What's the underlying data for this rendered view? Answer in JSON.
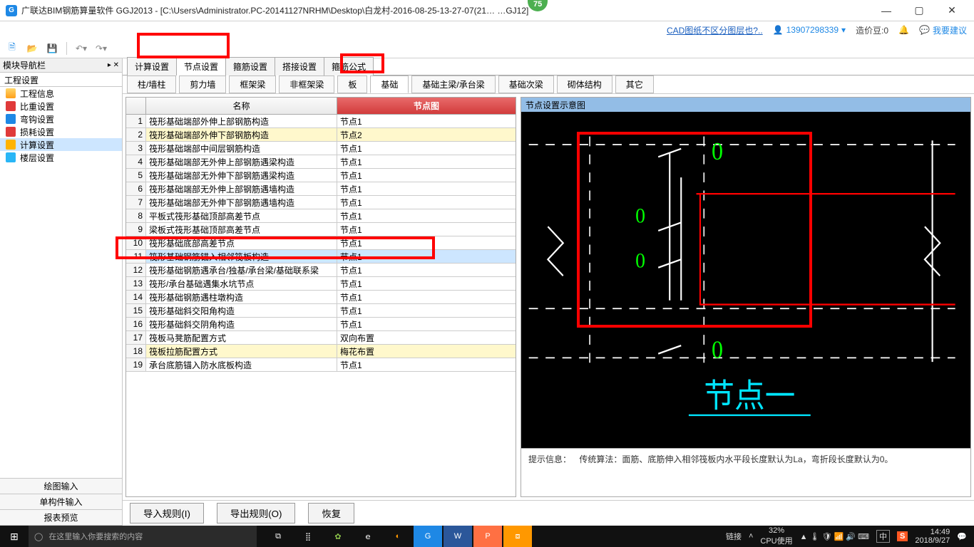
{
  "window": {
    "title": "广联达BIM钢筋算量软件 GGJ2013 - [C:\\Users\\Administrator.PC-20141127NRHM\\Desktop\\白龙村-2016-08-25-13-27-07(21…  …GJ12]",
    "badge": "75"
  },
  "infobar": {
    "cadlink": "CAD图纸不区分图层也?..",
    "phone": "13907298339",
    "credit": "造价豆:0",
    "feedback": "我要建议"
  },
  "leftpanel": {
    "nav_header": "模块导航栏",
    "group": "工程设置",
    "items": [
      "工程信息",
      "比重设置",
      "弯钩设置",
      "损耗设置",
      "计算设置",
      "楼层设置"
    ],
    "selected_index": 4,
    "bottom": [
      "绘图输入",
      "单构件输入",
      "报表预览"
    ]
  },
  "tabs1": [
    "计算设置",
    "节点设置",
    "箍筋设置",
    "搭接设置",
    "箍筋公式"
  ],
  "tabs1_active": 1,
  "tabs2": [
    "柱/墙柱",
    "剪力墙",
    "框架梁",
    "非框架梁",
    "板",
    "基础",
    "基础主梁/承台梁",
    "基础次梁",
    "砌体结构",
    "其它"
  ],
  "tabs2_active": 5,
  "table": {
    "headers": {
      "idx": "",
      "name": "名称",
      "node": "节点图"
    },
    "rows": [
      {
        "n": 1,
        "name": "筏形基础端部外伸上部钢筋构造",
        "node": "节点1",
        "hl": false
      },
      {
        "n": 2,
        "name": "筏形基础端部外伸下部钢筋构造",
        "node": "节点2",
        "hl": true,
        "hlnode": true
      },
      {
        "n": 3,
        "name": "筏形基础端部中间层钢筋构造",
        "node": "节点1",
        "hl": false
      },
      {
        "n": 4,
        "name": "筏形基础端部无外伸上部钢筋遇梁构造",
        "node": "节点1",
        "hl": false
      },
      {
        "n": 5,
        "name": "筏形基础端部无外伸下部钢筋遇梁构造",
        "node": "节点1",
        "hl": false
      },
      {
        "n": 6,
        "name": "筏形基础端部无外伸上部钢筋遇墙构造",
        "node": "节点1",
        "hl": false
      },
      {
        "n": 7,
        "name": "筏形基础端部无外伸下部钢筋遇墙构造",
        "node": "节点1",
        "hl": false
      },
      {
        "n": 8,
        "name": "平板式筏形基础顶部高差节点",
        "node": "节点1",
        "hl": false
      },
      {
        "n": 9,
        "name": "梁板式筏形基础顶部高差节点",
        "node": "节点1",
        "hl": false
      },
      {
        "n": 10,
        "name": "筏形基础底部高差节点",
        "node": "节点1",
        "hl": false
      },
      {
        "n": 11,
        "name": "筏形基础钢筋锚入相邻筏板构造",
        "node": "节点1",
        "sel": true
      },
      {
        "n": 12,
        "name": "筏形基础钢筋遇承台/独基/承台梁/基础联系梁",
        "node": "节点1",
        "hl": false
      },
      {
        "n": 13,
        "name": "筏形/承台基础遇集水坑节点",
        "node": "节点1",
        "hl": false
      },
      {
        "n": 14,
        "name": "筏形基础钢筋遇柱墩构造",
        "node": "节点1",
        "hl": false
      },
      {
        "n": 15,
        "name": "筏形基础斜交阳角构造",
        "node": "节点1",
        "hl": false
      },
      {
        "n": 16,
        "name": "筏形基础斜交阴角构造",
        "node": "节点1",
        "hl": false
      },
      {
        "n": 17,
        "name": "筏板马凳筋配置方式",
        "node": "双向布置",
        "hl": false
      },
      {
        "n": 18,
        "name": "筏板拉筋配置方式",
        "node": "梅花布置",
        "hl": true,
        "hlnode": true
      },
      {
        "n": 19,
        "name": "承台底筋锚入防水底板构造",
        "node": "节点1",
        "hl": false
      }
    ]
  },
  "diagram": {
    "header": "节点设置示意图",
    "caption": "节点一",
    "hint_label": "提示信息：",
    "hint_text": "传统算法：面筋、底筋伸入相邻筏板内水平段长度默认为La，弯折段长度默认为0。",
    "zero": "0"
  },
  "actions": {
    "import": "导入规则(I)",
    "export": "导出规则(O)",
    "restore": "恢复"
  },
  "taskbar": {
    "search_placeholder": "在这里输入你要搜索的内容",
    "link": "链接",
    "cpu_pct": "32%",
    "cpu_label": "CPU使用",
    "time": "14:49",
    "date": "2018/9/27",
    "ime": "中"
  }
}
